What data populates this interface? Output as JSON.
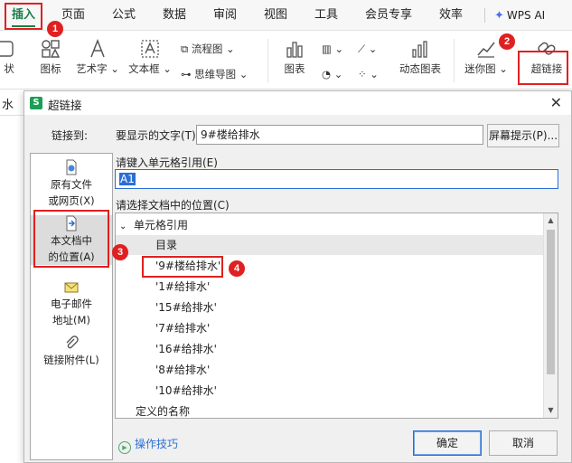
{
  "menu": {
    "tabs": [
      "插入",
      "页面",
      "公式",
      "数据",
      "审阅",
      "视图",
      "工具",
      "会员专享",
      "效率"
    ],
    "ai_label": "WPS AI"
  },
  "ribbon": {
    "shape_partial": "状",
    "icon_btn": "图标",
    "art_text": "艺术字",
    "text_box": "文本框",
    "flowchart": "流程图",
    "mindmap": "思维导图",
    "chart": "图表",
    "dyn_chart": "动态图表",
    "sparkline": "迷你图",
    "hyperlink": "超链接"
  },
  "formula_partial": "水",
  "dialog": {
    "title": "超链接",
    "link_to": "链接到:",
    "display_text_label": "要显示的文字(T):",
    "display_text_value": "9#楼给排水",
    "screen_tip_button": "屏幕提示(P)...",
    "cell_ref_label": "请键入单元格引用(E)",
    "cell_ref_value": "A1",
    "location_label": "请选择文档中的位置(C)",
    "link_options": [
      {
        "line1": "原有文件",
        "line2": "或网页(X)"
      },
      {
        "line1": "本文档中",
        "line2": "的位置(A)"
      },
      {
        "line1": "电子邮件",
        "line2": "地址(M)"
      },
      {
        "line1": "链接附件(L)",
        "line2": ""
      }
    ],
    "tree": {
      "root": "单元格引用",
      "items": [
        "目录",
        "'9#楼给排水'",
        "'1#给排水'",
        "'15#给排水'",
        "'7#给排水'",
        "'16#给排水'",
        "'8#给排水'",
        "'10#给排水'"
      ],
      "defined_names": "定义的名称"
    },
    "tips_link": "操作技巧",
    "ok": "确定",
    "cancel": "取消"
  },
  "badges": [
    "1",
    "2",
    "3",
    "4"
  ],
  "colors": {
    "accent": "#1a7f4b",
    "annotation": "#e02020"
  }
}
